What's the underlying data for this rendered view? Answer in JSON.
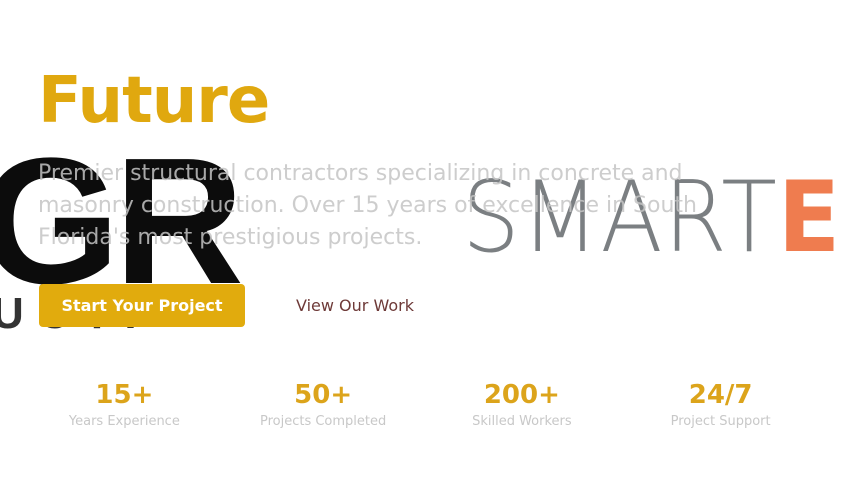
{
  "hero": {
    "headline": "Future",
    "subtitle": "Premier structural contractors specializing in concrete and masonry construction. Over 15 years of excellence in South Florida's most prestigious projects.",
    "primary_button": "Start Your Project",
    "secondary_link": "View Our Work"
  },
  "logos": {
    "left_logo_text": "GR",
    "left_logo_subtext": "UCTI",
    "right_logo_text": "SMART",
    "right_logo_accent": "E"
  },
  "stats": [
    {
      "value": "15+",
      "label": "Years Experience"
    },
    {
      "value": "50+",
      "label": "Projects Completed"
    },
    {
      "value": "200+",
      "label": "Skilled Workers"
    },
    {
      "value": "24/7",
      "label": "Project Support"
    }
  ],
  "colors": {
    "accent": "#e1ab0d",
    "link": "#6e3a38",
    "muted_text": "#c8c8c8",
    "logo_gray": "#7b7f82",
    "logo_orange": "#ef7c4f"
  }
}
